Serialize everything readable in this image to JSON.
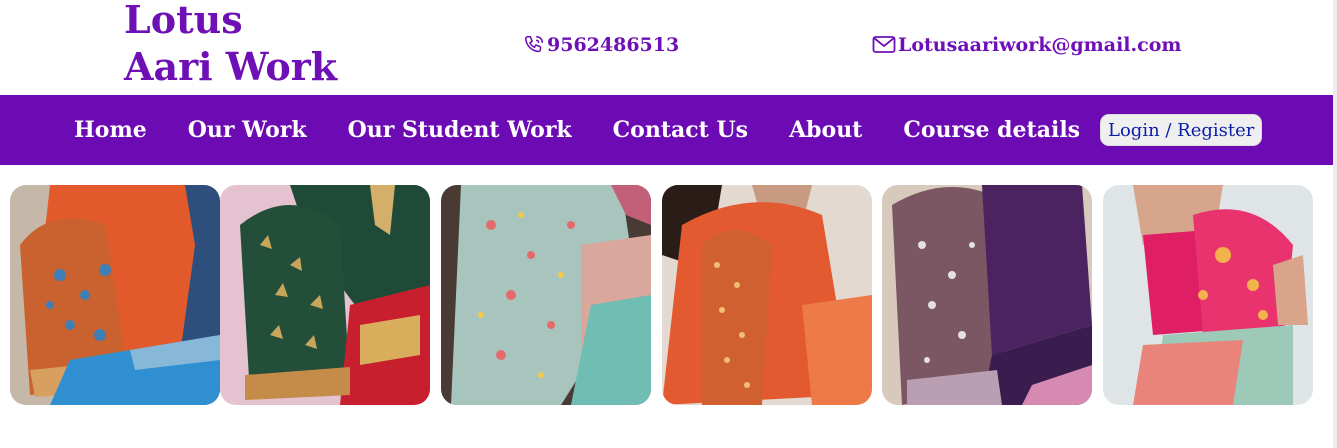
{
  "brand": {
    "line1": "Lotus",
    "line2": "Aari Work"
  },
  "contact": {
    "phone": "9562486513",
    "phone_icon": "phone-icon",
    "email": "Lotusaariwork@gmail.com",
    "email_icon": "mail-icon"
  },
  "nav": {
    "items": [
      {
        "label": "Home"
      },
      {
        "label": "Our Work"
      },
      {
        "label": "Our Student Work"
      },
      {
        "label": "Contact Us"
      },
      {
        "label": "About"
      },
      {
        "label": "Course details"
      }
    ],
    "login_label": "Login / Register"
  },
  "colors": {
    "brand": "#6f10b6",
    "nav_bg": "#6c0bb4",
    "nav_text": "#ffffff",
    "login_text": "#0a1ea8",
    "login_bg": "#efefef"
  },
  "gallery": {
    "images": [
      {
        "name": "blouse-photo-orange-blue"
      },
      {
        "name": "blouse-photo-green-gold"
      },
      {
        "name": "blouse-photo-mint-floral"
      },
      {
        "name": "blouse-photo-orange-sleeve"
      },
      {
        "name": "blouse-photo-purple-lace"
      },
      {
        "name": "blouse-photo-pink-back"
      }
    ]
  }
}
